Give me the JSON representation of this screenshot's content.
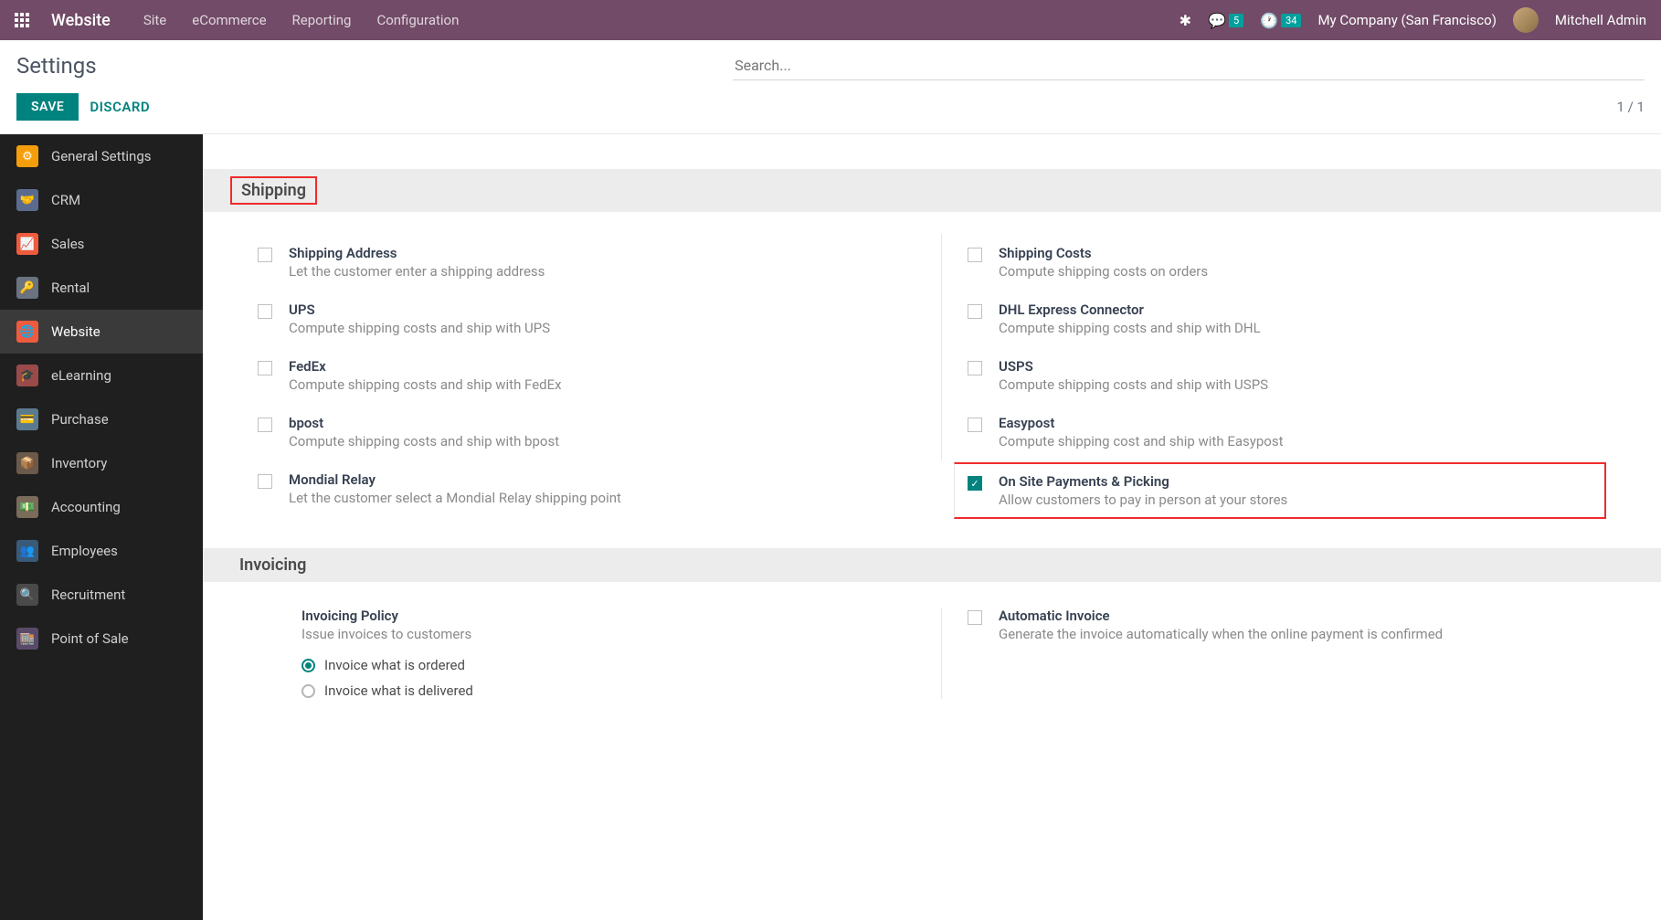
{
  "navbar": {
    "appName": "Website",
    "menu": [
      "Site",
      "eCommerce",
      "Reporting",
      "Configuration"
    ],
    "chatBadge": "5",
    "clockBadge": "34",
    "company": "My Company (San Francisco)",
    "user": "Mitchell Admin"
  },
  "controlBar": {
    "title": "Settings",
    "searchPlaceholder": "Search...",
    "save": "SAVE",
    "discard": "DISCARD",
    "pager": "1 / 1"
  },
  "sidebar": {
    "items": [
      {
        "label": "General Settings"
      },
      {
        "label": "CRM"
      },
      {
        "label": "Sales"
      },
      {
        "label": "Rental"
      },
      {
        "label": "Website"
      },
      {
        "label": "eLearning"
      },
      {
        "label": "Purchase"
      },
      {
        "label": "Inventory"
      },
      {
        "label": "Accounting"
      },
      {
        "label": "Employees"
      },
      {
        "label": "Recruitment"
      },
      {
        "label": "Point of Sale"
      }
    ]
  },
  "sections": {
    "shipping": {
      "title": "Shipping",
      "rows": [
        {
          "title": "Shipping Address",
          "desc": "Let the customer enter a shipping address"
        },
        {
          "title": "Shipping Costs",
          "desc": "Compute shipping costs on orders"
        },
        {
          "title": "UPS",
          "desc": "Compute shipping costs and ship with UPS"
        },
        {
          "title": "DHL Express Connector",
          "desc": "Compute shipping costs and ship with DHL"
        },
        {
          "title": "FedEx",
          "desc": "Compute shipping costs and ship with FedEx"
        },
        {
          "title": "USPS",
          "desc": "Compute shipping costs and ship with USPS"
        },
        {
          "title": "bpost",
          "desc": "Compute shipping costs and ship with bpost"
        },
        {
          "title": "Easypost",
          "desc": "Compute shipping cost and ship with Easypost"
        },
        {
          "title": "Mondial Relay",
          "desc": "Let the customer select a Mondial Relay shipping point"
        },
        {
          "title": "On Site Payments & Picking",
          "desc": "Allow customers to pay in person at your stores"
        }
      ]
    },
    "invoicing": {
      "title": "Invoicing",
      "policyTitle": "Invoicing Policy",
      "policyDesc": "Issue invoices to customers",
      "radio1": "Invoice what is ordered",
      "radio2": "Invoice what is delivered",
      "autoTitle": "Automatic Invoice",
      "autoDesc": "Generate the invoice automatically when the online payment is confirmed"
    }
  }
}
